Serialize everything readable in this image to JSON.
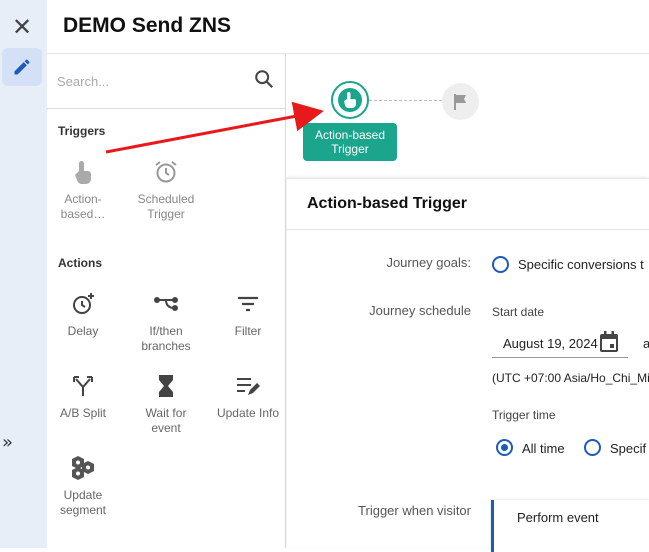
{
  "rail": {
    "close_icon": "close-icon",
    "edit_icon": "pencil-icon",
    "expand_label": "»"
  },
  "header": {
    "title": "DEMO Send ZNS"
  },
  "search": {
    "placeholder": "Search..."
  },
  "sidebar": {
    "triggers_heading": "Triggers",
    "triggers": [
      {
        "label": "Action-\nbased…",
        "icon": "touch-icon"
      },
      {
        "label": "Scheduled\nTrigger",
        "icon": "alarm-icon"
      }
    ],
    "actions_heading": "Actions",
    "actions": [
      {
        "label": "Delay",
        "icon": "delay-icon"
      },
      {
        "label": "If/then\nbranches",
        "icon": "branch-icon"
      },
      {
        "label": "Filter",
        "icon": "filter-icon"
      },
      {
        "label": "A/B Split",
        "icon": "split-icon"
      },
      {
        "label": "Wait for\nevent",
        "icon": "hourglass-icon"
      },
      {
        "label": "Update Info",
        "icon": "edit-list-icon"
      },
      {
        "label": "Update\nsegment",
        "icon": "segment-icon"
      }
    ]
  },
  "canvas": {
    "node_label": "Action-based\nTrigger",
    "accent": "#1aa58c"
  },
  "panel": {
    "title": "Action-based Trigger",
    "journey_goals_label": "Journey goals:",
    "journey_goals_option": "Specific conversions t",
    "journey_schedule_label": "Journey schedule",
    "start_date_label": "Start date",
    "start_date_value": "August 19, 2024",
    "start_date_trailing": "a",
    "timezone": "(UTC +07:00 Asia/Ho_Chi_Mi",
    "trigger_time_label": "Trigger time",
    "trigger_time_all": "All time",
    "trigger_time_specific": "Specif",
    "trigger_when_label": "Trigger when visitor",
    "perform_event": "Perform event"
  },
  "colors": {
    "primary": "#1c5bb8",
    "accent": "#1aa58c",
    "annotation": "#e8191a"
  }
}
